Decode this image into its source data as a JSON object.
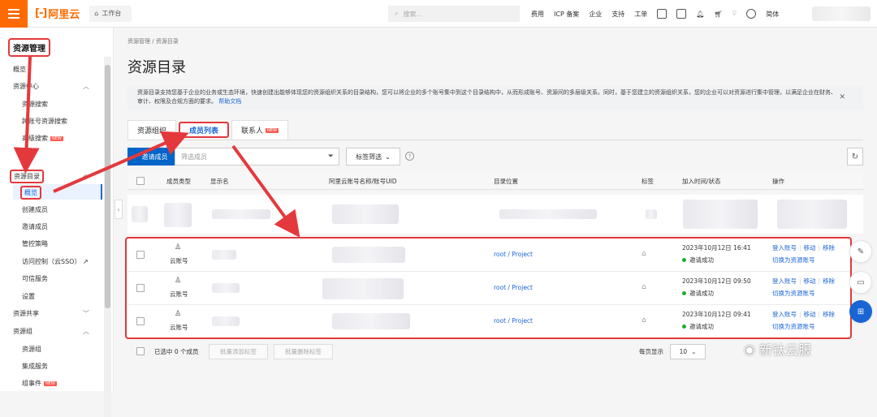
{
  "topbar": {
    "logo_text": "阿里云",
    "workspace_label": "工作台",
    "search_placeholder": "搜索...",
    "nav": [
      "费用",
      "ICP 备案",
      "企业",
      "支持",
      "工单"
    ],
    "language": "简体"
  },
  "sidebar": {
    "title": "资源管理",
    "items": [
      {
        "label": "概览"
      },
      {
        "label": "资源中心"
      },
      {
        "label": "资源搜索"
      },
      {
        "label": "跨账号资源搜索"
      },
      {
        "label": "高级搜索",
        "badge": "NEW"
      },
      {
        "label": "设置"
      },
      {
        "label": "资源目录"
      },
      {
        "label": "概览"
      },
      {
        "label": "创建成员"
      },
      {
        "label": "邀请成员"
      },
      {
        "label": "管控策略"
      },
      {
        "label": "访问控制（云SSO）"
      },
      {
        "label": "可信服务"
      },
      {
        "label": "设置"
      },
      {
        "label": "资源共享"
      },
      {
        "label": "资源组"
      },
      {
        "label": "资源组"
      },
      {
        "label": "集成服务"
      },
      {
        "label": "组事件",
        "badge": "NEW"
      }
    ]
  },
  "main": {
    "breadcrumb": "资源管理  /  资源目录",
    "title": "资源目录",
    "notice": "资源目录支持您基于企业的业务或生态环境，快速创建出能够体现您的资源组织关系的目录结构，您可以将企业的多个账号集中到这个目录结构中，从而形成账号、资源间的多层级关系。同时，基于您建立的资源组织关系，您的企业可以对资源进行集中管理，以满足企业在财务、审计、权限及合规方面的要求。",
    "notice_link": "帮助文档",
    "tabs": [
      "资源组织",
      "成员列表",
      "联系人"
    ],
    "tab_badge": "NEW",
    "add_member_label": "邀请成员",
    "filter_placeholder": "筛选成员",
    "tag_filter_label": "标签筛选",
    "columns": [
      "成员类型",
      "显示名",
      "阿里云账号名称/账号UID",
      "目录位置",
      "标签",
      "加入时间/状态",
      "操作"
    ],
    "rows": [
      {
        "type": "云账号",
        "dir": "root / Project",
        "time": "2023年10月12日 16:41",
        "status": "邀请成功",
        "ops": [
          "登入账号",
          "移动",
          "移除"
        ],
        "ops2": "切换为资源账号"
      },
      {
        "type": "云账号",
        "dir": "root / Project",
        "time": "2023年10月12日 09:50",
        "status": "邀请成功",
        "ops": [
          "登入账号",
          "移动",
          "移除"
        ],
        "ops2": "切换为资源账号"
      },
      {
        "type": "云账号",
        "dir": "root / Project",
        "time": "2023年10月12日 09:41",
        "status": "邀请成功",
        "ops": [
          "登入账号",
          "移动",
          "移除"
        ],
        "ops2": "切换为资源账号"
      }
    ],
    "footer": {
      "selected_text": "已选中 0 个成员",
      "bulk_add_tag": "批量添加标签",
      "bulk_remove_tag": "批量删除标签",
      "page_size_label": "每页显示",
      "page_size": "10"
    }
  },
  "watermark": "新钛云服",
  "colors": {
    "brand": "#ff6a00",
    "primary": "#0064c8",
    "link": "#1965d4",
    "highlight": "#e4393c",
    "success": "#22aa33"
  }
}
